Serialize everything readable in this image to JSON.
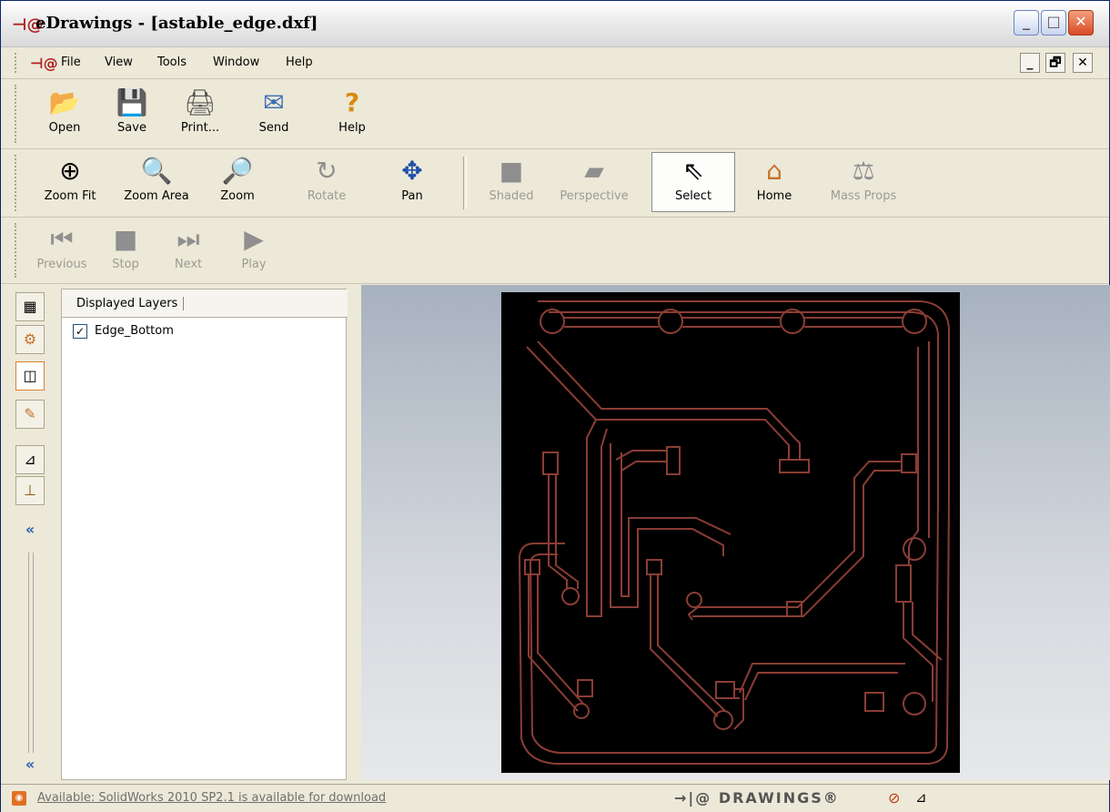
{
  "window": {
    "title": "eDrawings - [astable_edge.dxf]",
    "title_icon": "edrawings-logo-icon",
    "controls": {
      "minimize": "_",
      "maximize": "□",
      "close": "✕"
    }
  },
  "menu": {
    "items": [
      {
        "label": "File"
      },
      {
        "label": "View"
      },
      {
        "label": "Tools"
      },
      {
        "label": "Window"
      },
      {
        "label": "Help"
      }
    ],
    "mdi_controls": {
      "minimize": "_",
      "restore": "🗗",
      "close": "✕"
    }
  },
  "toolbar_file": [
    {
      "label": "Open",
      "icon": "folder-open-icon",
      "glyph": "📂"
    },
    {
      "label": "Save",
      "icon": "floppy-save-icon",
      "glyph": "💾"
    },
    {
      "label": "Print...",
      "icon": "printer-icon",
      "glyph": "🖨"
    },
    {
      "label": "Send",
      "icon": "envelope-send-icon",
      "glyph": "✉"
    },
    {
      "label": "Help",
      "icon": "help-question-icon",
      "glyph": "?"
    }
  ],
  "toolbar_view": [
    {
      "label": "Zoom Fit",
      "icon": "zoom-fit-icon",
      "glyph": "⊕",
      "enabled": true
    },
    {
      "label": "Zoom Area",
      "icon": "zoom-area-icon",
      "glyph": "🔍",
      "enabled": true
    },
    {
      "label": "Zoom",
      "icon": "zoom-icon",
      "glyph": "🔎",
      "enabled": true
    },
    {
      "label": "Rotate",
      "icon": "rotate-icon",
      "glyph": "↻",
      "enabled": false
    },
    {
      "label": "Pan",
      "icon": "pan-arrows-icon",
      "glyph": "✥",
      "enabled": true
    },
    {
      "label": "Shaded",
      "icon": "shaded-icon",
      "glyph": "■",
      "enabled": false
    },
    {
      "label": "Perspective",
      "icon": "perspective-icon",
      "glyph": "▰",
      "enabled": false
    },
    {
      "label": "Select",
      "icon": "select-arrow-icon",
      "glyph": "⇖",
      "enabled": true,
      "selected": true
    },
    {
      "label": "Home",
      "icon": "home-icon",
      "glyph": "⌂",
      "enabled": true
    },
    {
      "label": "Mass Props",
      "icon": "mass-props-icon",
      "glyph": "⚖",
      "enabled": false
    }
  ],
  "toolbar_playback": [
    {
      "label": "Previous",
      "icon": "previous-icon",
      "glyph": "⏮"
    },
    {
      "label": "Stop",
      "icon": "stop-icon",
      "glyph": "■"
    },
    {
      "label": "Next",
      "icon": "next-icon",
      "glyph": "⏭"
    },
    {
      "label": "Play",
      "icon": "play-icon",
      "glyph": "▶"
    }
  ],
  "side_tabs": [
    {
      "icon": "sheets-tab-icon",
      "glyph": "▦"
    },
    {
      "icon": "components-tab-icon",
      "glyph": "⚙"
    },
    {
      "icon": "layers-tab-icon",
      "glyph": "◫",
      "active": true
    },
    {
      "icon": "markup-pencil-icon",
      "glyph": "✎"
    },
    {
      "icon": "measure-tab-icon",
      "glyph": "⊿"
    },
    {
      "icon": "stamp-tab-icon",
      "glyph": "⊥"
    },
    {
      "icon": "collapse-panel-icon",
      "glyph": "«"
    }
  ],
  "layers_panel": {
    "header": "Displayed Layers",
    "layers": [
      {
        "name": "Edge_Bottom",
        "checked": true
      }
    ],
    "collapse_glyph": "«"
  },
  "colors": {
    "board_background": "#000000",
    "trace_color": "#8a3d35",
    "viewport_top": "#a7b2bf",
    "viewport_bottom": "#e7e8ea"
  },
  "status": {
    "message": "Available: SolidWorks 2010 SP2.1 is available for download",
    "brand": "→|@ DRAWINGS®",
    "rss_glyph": "rss"
  }
}
